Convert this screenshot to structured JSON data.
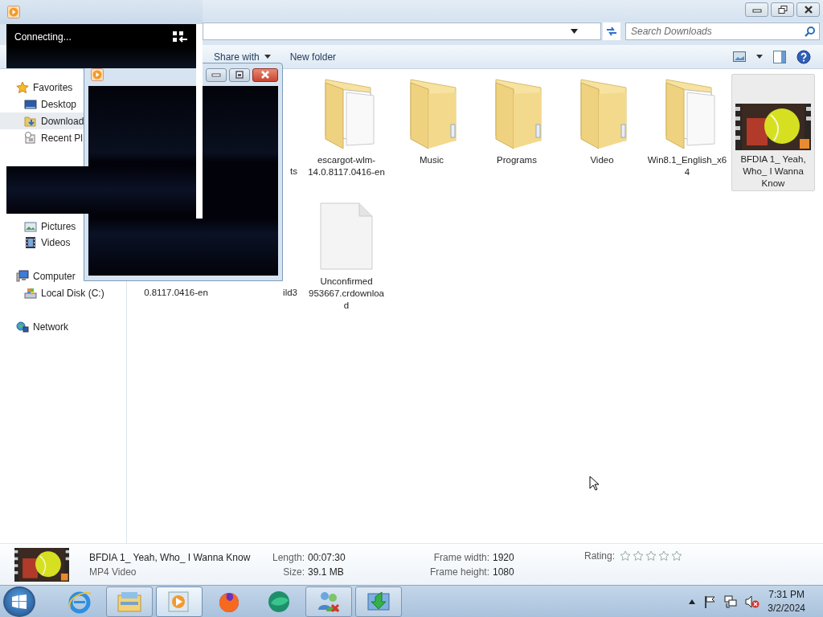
{
  "player": {
    "status": "Connecting..."
  },
  "explorer": {
    "search": {
      "placeholder": "Search Downloads"
    },
    "toolbar": [
      {
        "label": "Share with",
        "kind": "menu"
      },
      {
        "label": "New folder",
        "kind": "plain"
      }
    ],
    "navigation": [
      {
        "header": "Favorites",
        "kind": "favorites",
        "items": [
          {
            "label": "Desktop",
            "kind": "desktop",
            "selected": false
          },
          {
            "label": "Download",
            "kind": "downloads",
            "selected": true
          },
          {
            "label": "Recent Pl",
            "kind": "recent",
            "selected": false
          }
        ]
      },
      {
        "items": [
          {
            "label": "Pictures",
            "kind": "pictures",
            "selected": false
          },
          {
            "label": "Videos",
            "kind": "videos",
            "selected": false
          }
        ]
      },
      {
        "header": "Computer",
        "kind": "computer",
        "items": [
          {
            "label": "Local Disk (C:)",
            "kind": "disk",
            "selected": false
          }
        ]
      },
      {
        "header": "Network",
        "kind": "network"
      }
    ],
    "files": [
      [
        {
          "label": "ts",
          "kind": "covered",
          "selected": false
        },
        {
          "label": "escargot-wlm-14.0.8117.0416-en",
          "kind": "folder-docs",
          "selected": false
        },
        {
          "label": "Music",
          "kind": "folder",
          "selected": false
        },
        {
          "label": "Programs",
          "kind": "folder",
          "selected": false
        },
        {
          "label": "Video",
          "kind": "folder",
          "selected": false
        },
        {
          "label": "Win8.1_English_x64",
          "kind": "folder-docs",
          "selected": false
        },
        {
          "label": "BFDIA 1_ Yeah, Who_ I Wanna Know",
          "kind": "video",
          "selected": true
        }
      ],
      [
        {
          "label": "0.8117.0416-en",
          "kind": "covered",
          "selected": false
        },
        {
          "label": "ild3",
          "kind": "covered",
          "selected": false
        },
        {
          "label": "Unconfirmed 953667.crdownload",
          "kind": "file",
          "selected": false
        }
      ]
    ],
    "details": {
      "name": "BFDIA 1_ Yeah, Who_ I Wanna Know",
      "type": "MP4 Video",
      "properties": [
        [
          {
            "label": "Length:",
            "value": "00:07:30"
          },
          {
            "label": "Size:",
            "value": "39.1 MB"
          }
        ],
        [
          {
            "label": "Frame width:",
            "value": "1920"
          },
          {
            "label": "Frame height:",
            "value": "1080"
          }
        ]
      ],
      "rating": {
        "label": "Rating:",
        "stars": 0
      }
    }
  },
  "taskbar": {
    "apps": [
      {
        "kind": "ie",
        "open": false,
        "active": false
      },
      {
        "kind": "explorer",
        "open": true,
        "active": false
      },
      {
        "kind": "player",
        "open": true,
        "active": true
      },
      {
        "kind": "firefox",
        "open": false,
        "active": false
      },
      {
        "kind": "orb",
        "open": false,
        "active": false
      },
      {
        "kind": "contacts",
        "open": true,
        "active": false
      },
      {
        "kind": "installer",
        "open": true,
        "active": false
      }
    ],
    "clock": {
      "time": "7:31 PM",
      "date": "3/2/2024"
    }
  }
}
